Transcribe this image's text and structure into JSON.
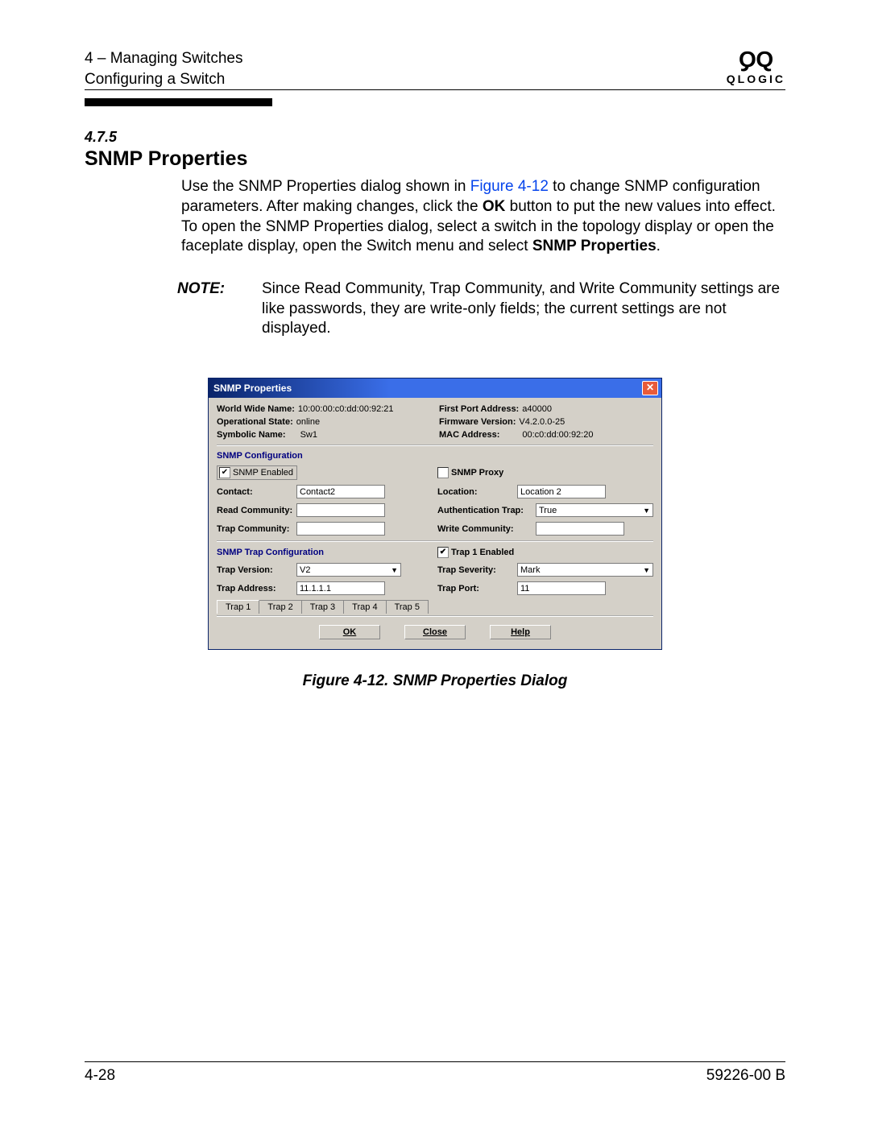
{
  "header": {
    "line1": "4 – Managing Switches",
    "line2": "Configuring a Switch",
    "brand": "QLOGIC"
  },
  "section": {
    "number": "4.7.5",
    "title": "SNMP Properties"
  },
  "para": {
    "t1": "Use the SNMP Properties dialog shown in ",
    "link": "Figure 4-12",
    "t2": " to change SNMP configuration parameters. After making changes, click the ",
    "bold1": "OK",
    "t3": " button to put the new values into effect. To open the SNMP Properties dialog, select a switch in the topology display or open the faceplate display, open the Switch menu and select ",
    "bold2": "SNMP Properties",
    "t4": "."
  },
  "note": {
    "label": "NOTE:",
    "text": "Since Read Community, Trap Community, and Write Community settings are like passwords, they are write-only fields; the current settings are not displayed."
  },
  "dialog": {
    "title": "SNMP Properties",
    "info": {
      "wwn_label": "World Wide Name:",
      "wwn_val": "10:00:00:c0:dd:00:92:21",
      "fpa_label": "First Port Address:",
      "fpa_val": "a40000",
      "op_label": "Operational State:",
      "op_val": "online",
      "fw_label": "Firmware Version:",
      "fw_val": "V4.2.0.0-25",
      "sym_label": "Symbolic Name:",
      "sym_val": "Sw1",
      "mac_label": "MAC Address:",
      "mac_val": "00:c0:dd:00:92:20"
    },
    "snmp": {
      "heading": "SNMP Configuration",
      "enabled_label": "SNMP Enabled",
      "enabled_checked": "✔",
      "proxy_label": "SNMP Proxy",
      "contact_label": "Contact:",
      "contact_val": "Contact2",
      "location_label": "Location:",
      "location_val": "Location 2",
      "read_label": "Read Community:",
      "auth_label": "Authentication Trap:",
      "auth_val": "True",
      "trapcomm_label": "Trap Community:",
      "writecomm_label": "Write Community:"
    },
    "trap": {
      "heading": "SNMP Trap Configuration",
      "enabled_label": "Trap 1 Enabled",
      "enabled_checked": "✔",
      "version_label": "Trap Version:",
      "version_val": "V2",
      "severity_label": "Trap Severity:",
      "severity_val": "Mark",
      "address_label": "Trap Address:",
      "address_val": "11.1.1.1",
      "port_label": "Trap Port:",
      "port_val": "11"
    },
    "tabs": [
      "Trap 1",
      "Trap 2",
      "Trap 3",
      "Trap 4",
      "Trap 5"
    ],
    "buttons": {
      "ok": "OK",
      "close": "Close",
      "help": "Help"
    }
  },
  "caption": "Figure 4-12.  SNMP Properties Dialog",
  "footer": {
    "left": "4-28",
    "right": "59226-00 B"
  }
}
